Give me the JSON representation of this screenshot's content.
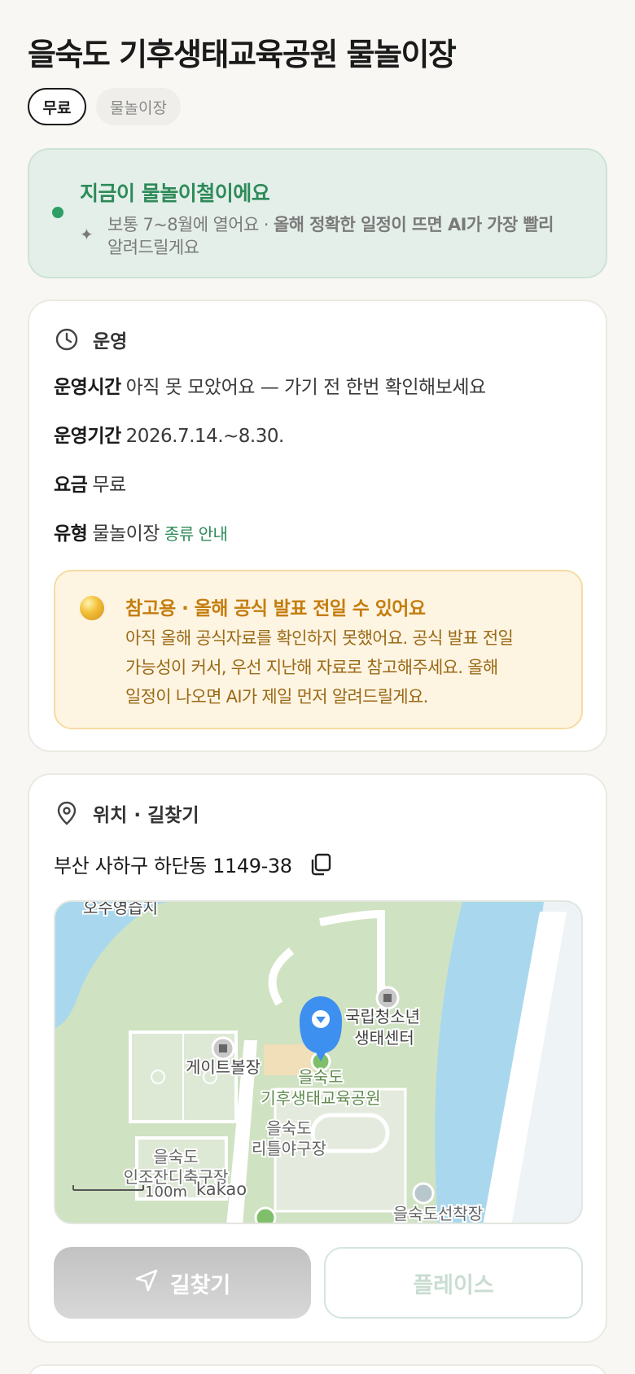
{
  "header": {
    "title": "을숙도 기후생태교육공원 물놀이장",
    "chips": [
      "무료",
      "물놀이장"
    ]
  },
  "season": {
    "headline": "지금이 물놀이철이에요",
    "desc_prefix": "보통 7~8월에 열어요 · ",
    "desc_emphasis": "올해 정확한 일정이 뜨면 AI가 가장 빨리",
    "desc_suffix": "알려드릴게요"
  },
  "operation": {
    "section_title": "운영",
    "rows": [
      {
        "label": "운영시간",
        "value": "아직 못 모았어요 — 가기 전 한번 확인해보세요"
      },
      {
        "label": "운영기간",
        "value": "2026.7.14.~8.30."
      },
      {
        "label": "요금",
        "value": "무료"
      },
      {
        "label": "유형",
        "value": "물놀이장",
        "link": "종류 안내"
      }
    ],
    "notice": {
      "title": "참고용 · 올해 공식 발표 전일 수 있어요",
      "lines": [
        "아직 올해 공식자료를 확인하지 못했어요. 공식 발표 전일",
        "가능성이 커서, 우선 지난해 자료로 참고해주세요. 올해",
        "일정이 나오면 AI가 제일 먼저 알려드릴게요."
      ]
    }
  },
  "location": {
    "section_title": "위치 · 길찾기",
    "address": "부산 사하구 하단동 1149-38",
    "map": {
      "labels": {
        "top_left": "오수영습지",
        "youth_center_1": "국립청소년",
        "youth_center_2": "생태센터",
        "gateball": "게이트볼장",
        "park_1": "을숙도",
        "park_2": "기후생태교육공원",
        "little_1": "을숙도",
        "little_2": "리틀야구장",
        "artificial_1": "을숙도",
        "artificial_2": "인조잔디축구장",
        "bottom_right": "을숙도선착장",
        "scale": "100m",
        "brand": "kakao"
      },
      "colors": {
        "water": "#a9d8ee",
        "park": "#cfe2c2",
        "pin": "#3d8ff0"
      }
    },
    "buttons": {
      "directions": "길찾기",
      "place": "플레이스"
    }
  }
}
